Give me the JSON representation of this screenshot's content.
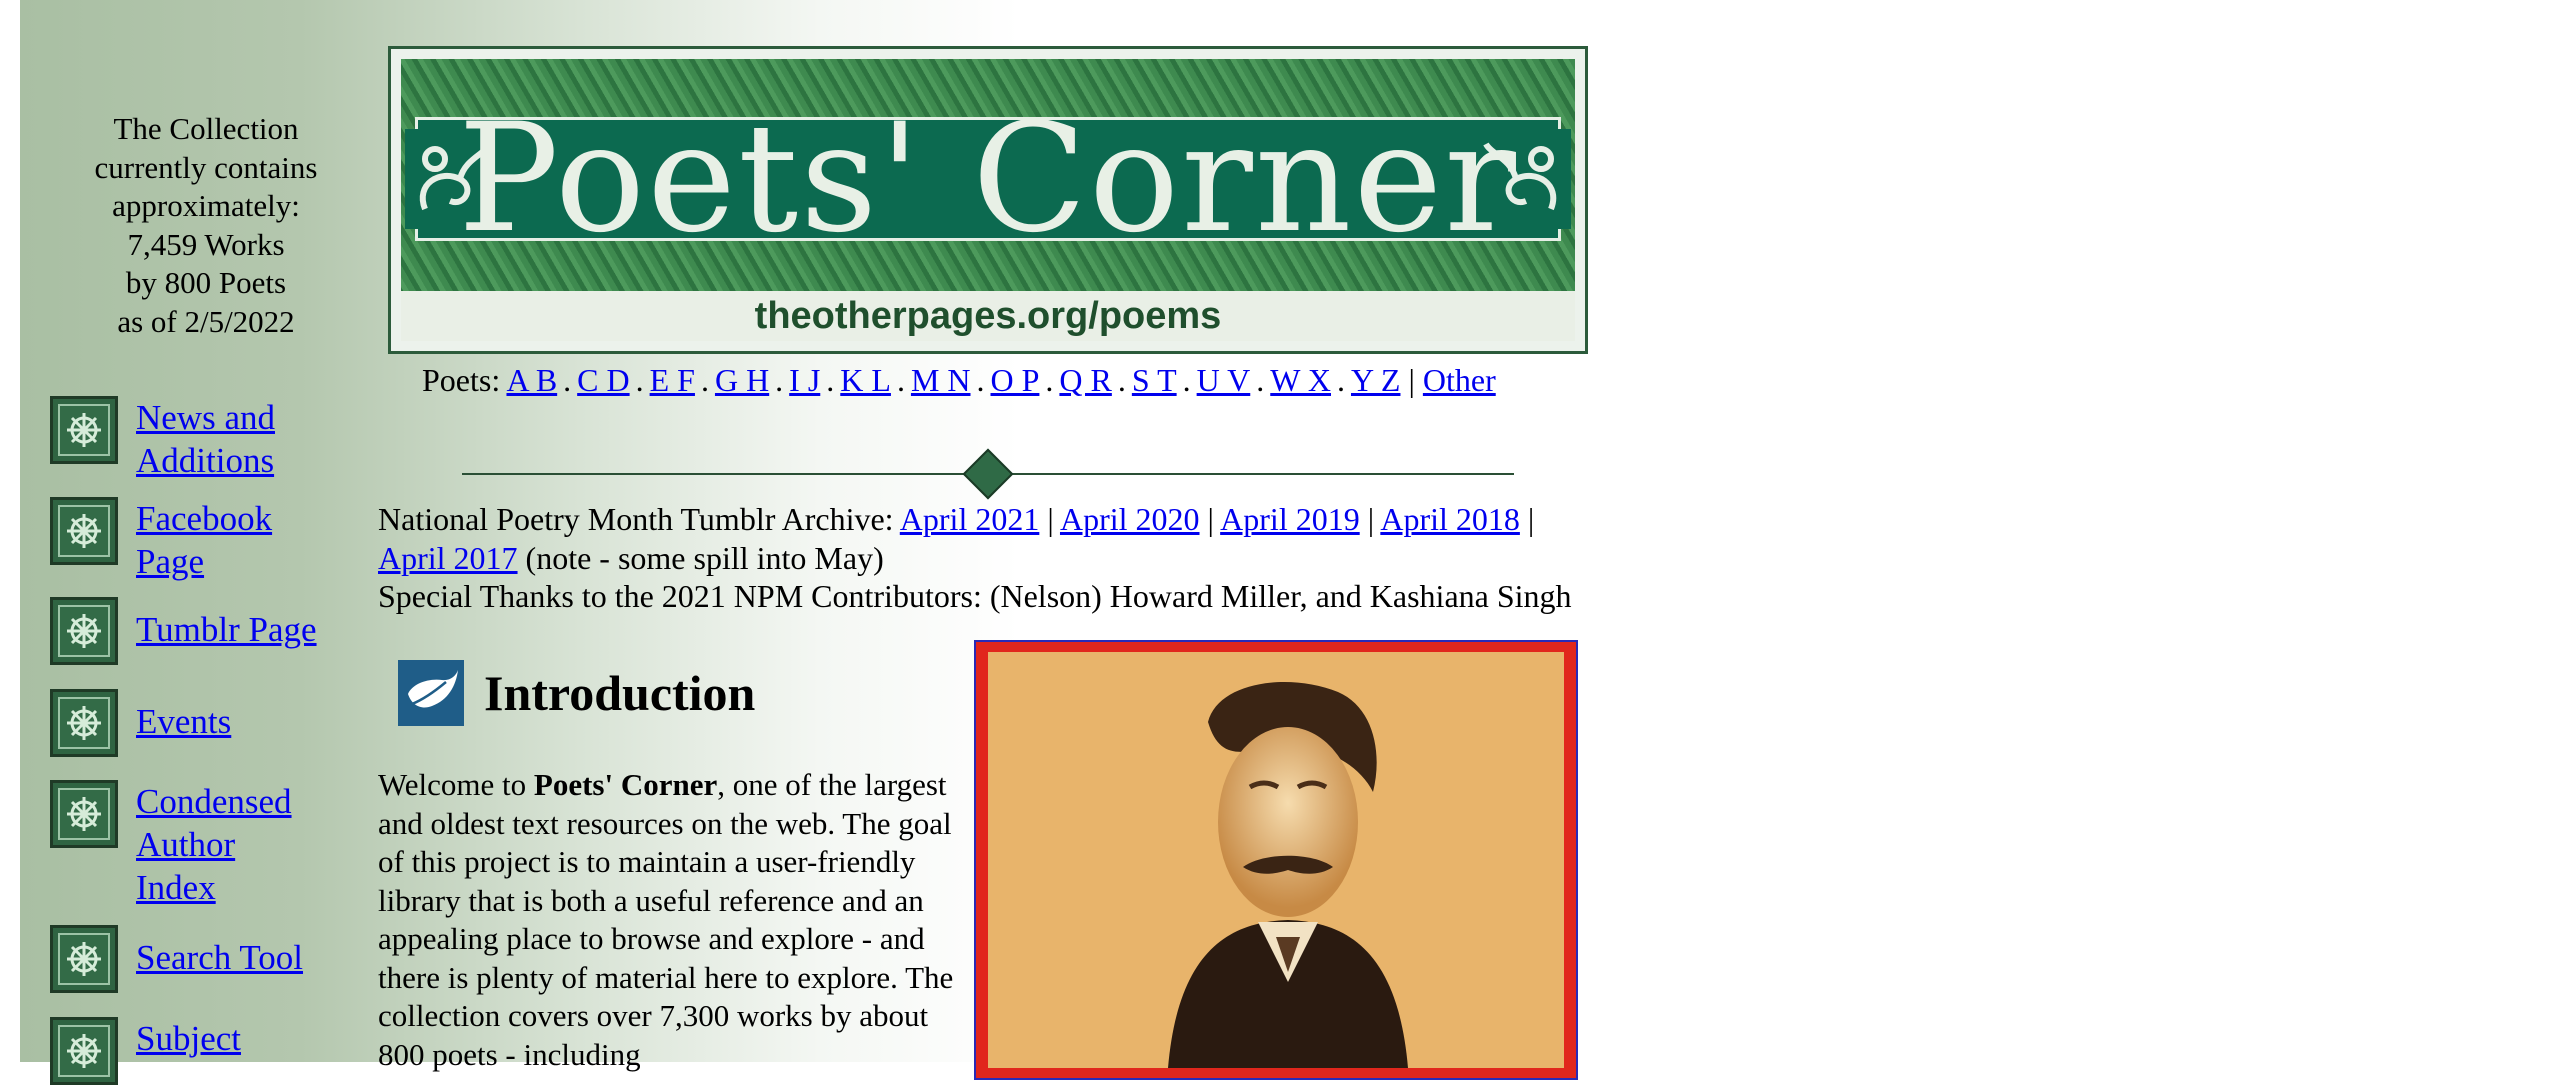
{
  "sidebar": {
    "stats": {
      "line1": "The Collection",
      "line2": "currently contains",
      "line3": "approximately:",
      "line4": "7,459 Works",
      "line5": "by 800 Poets",
      "line6": "as of 2/5/2022"
    },
    "nav": [
      {
        "label_lines": [
          "News and",
          "Additions"
        ],
        "icon": "celtic-knot-icon"
      },
      {
        "label_lines": [
          "Facebook",
          "Page"
        ],
        "icon": "celtic-knot-icon"
      },
      {
        "label_lines": [
          "Tumblr Page"
        ],
        "icon": "celtic-knot-icon"
      },
      {
        "label_lines": [
          "Events"
        ],
        "icon": "celtic-knot-icon"
      },
      {
        "label_lines": [
          "Condensed",
          "Author",
          "Index"
        ],
        "icon": "celtic-knot-icon"
      },
      {
        "label_lines": [
          "Search Tool"
        ],
        "icon": "celtic-knot-icon"
      },
      {
        "label_lines": [
          "Subject"
        ],
        "icon": "celtic-knot-icon"
      }
    ]
  },
  "banner": {
    "title": "Poets' Corner",
    "url": "theotherpages.org/poems"
  },
  "poets_nav": {
    "prefix": "Poets:",
    "letters": [
      "A B",
      "C D",
      "E F",
      "G H",
      "I J",
      "K L",
      "M N",
      "O P",
      "Q R",
      "S T",
      "U V",
      "W X",
      "Y Z"
    ],
    "letter_separator": ".",
    "other_separator": "|",
    "other": "Other"
  },
  "archive": {
    "label": "National Poetry Month Tumblr Archive:",
    "links": [
      "April 2021",
      "April 2020",
      "April 2019",
      "April 2018",
      "April 2017"
    ],
    "separator": "|",
    "note": "(note - some spill into May)",
    "thanks": "Special Thanks to the 2021 NPM Contributors: (Nelson) Howard Miller, and Kashiana Singh"
  },
  "intro": {
    "heading": "Introduction",
    "text_before": "Welcome to ",
    "text_bold": "Poets' Corner",
    "text_after": ", one of the largest and oldest text resources on the web. The goal of this project is to maintain a user-friendly library that is both a useful reference and an appealing place to browse and explore - and there is plenty of material here to explore. The collection covers over 7,300 works by about 800 poets - including"
  },
  "colors": {
    "link": "#0000ee",
    "sidebar_bg": "#a9bfa3",
    "banner_green": "#0c6a50",
    "portrait_border": "#e1261c"
  }
}
